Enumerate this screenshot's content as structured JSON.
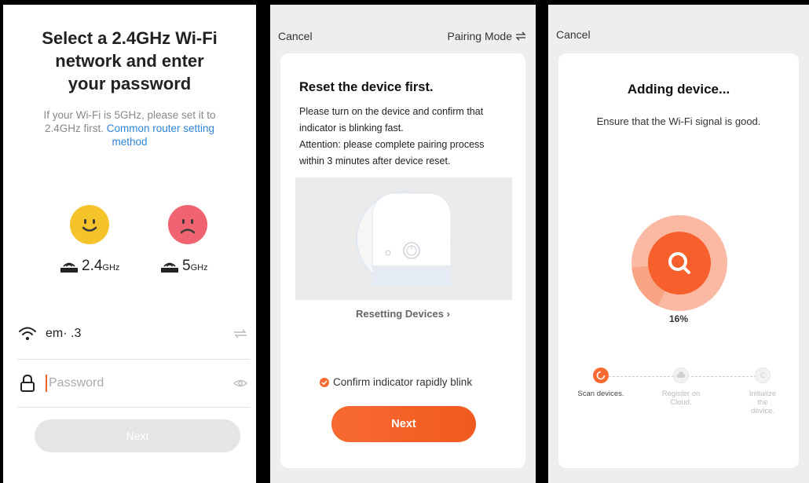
{
  "screen1": {
    "title": "Select a 2.4GHz Wi-Fi\nnetwork and enter\nyour password",
    "info_text": "If your Wi-Fi is 5GHz, please set it to 2.4GHz first.",
    "info_link": "Common router setting method",
    "bands": [
      {
        "number": "2.4",
        "unit": "GHz"
      },
      {
        "number": "5",
        "unit": "GHz"
      }
    ],
    "ssid": "em·      .3",
    "password_placeholder": "Password",
    "next_label": "Next",
    "colors": {
      "happy": "#f5c32a",
      "sad": "#ef6470",
      "link": "#2e84d8"
    }
  },
  "screen2": {
    "cancel_label": "Cancel",
    "mode_label": "Pairing Mode",
    "title": "Reset the device first.",
    "body_line1": "Please turn on the device and confirm that indicator is blinking fast.",
    "body_line2": "Attention: please complete pairing process within 3 minutes after device reset.",
    "reset_link": "Resetting Devices",
    "confirm_label": "Confirm indicator rapidly blink",
    "next_label": "Next",
    "accent": "#f86a32"
  },
  "screen3": {
    "cancel_label": "Cancel",
    "title": "Adding device...",
    "subtitle": "Ensure that the Wi-Fi signal is good.",
    "progress_percent": 16,
    "progress_text": "16%",
    "steps": [
      {
        "label": "Scan devices.",
        "active": true
      },
      {
        "label": "Register on Cloud.",
        "active": false
      },
      {
        "label": "Initialize the device.",
        "active": false
      }
    ]
  }
}
